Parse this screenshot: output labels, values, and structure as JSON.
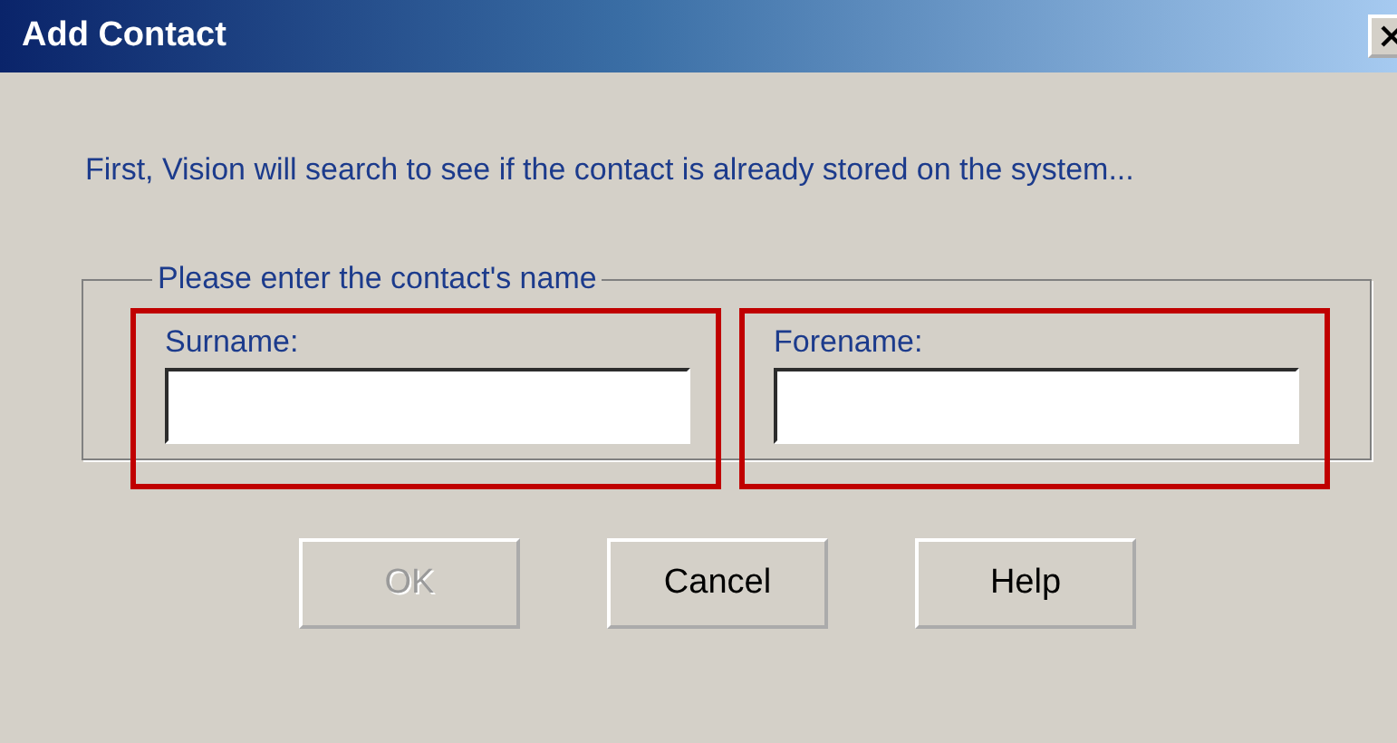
{
  "window": {
    "title": "Add Contact"
  },
  "message": "First, Vision will search to see if the contact is already stored on the system...",
  "group": {
    "legend": "Please enter the contact's name",
    "fields": [
      {
        "label": "Surname:",
        "highlighted": true
      },
      {
        "label": "Forename:",
        "highlighted": true
      }
    ]
  },
  "buttons": [
    {
      "label": "OK",
      "disabled": true
    },
    {
      "label": "Cancel",
      "disabled": false
    },
    {
      "label": "Help",
      "disabled": false
    }
  ]
}
